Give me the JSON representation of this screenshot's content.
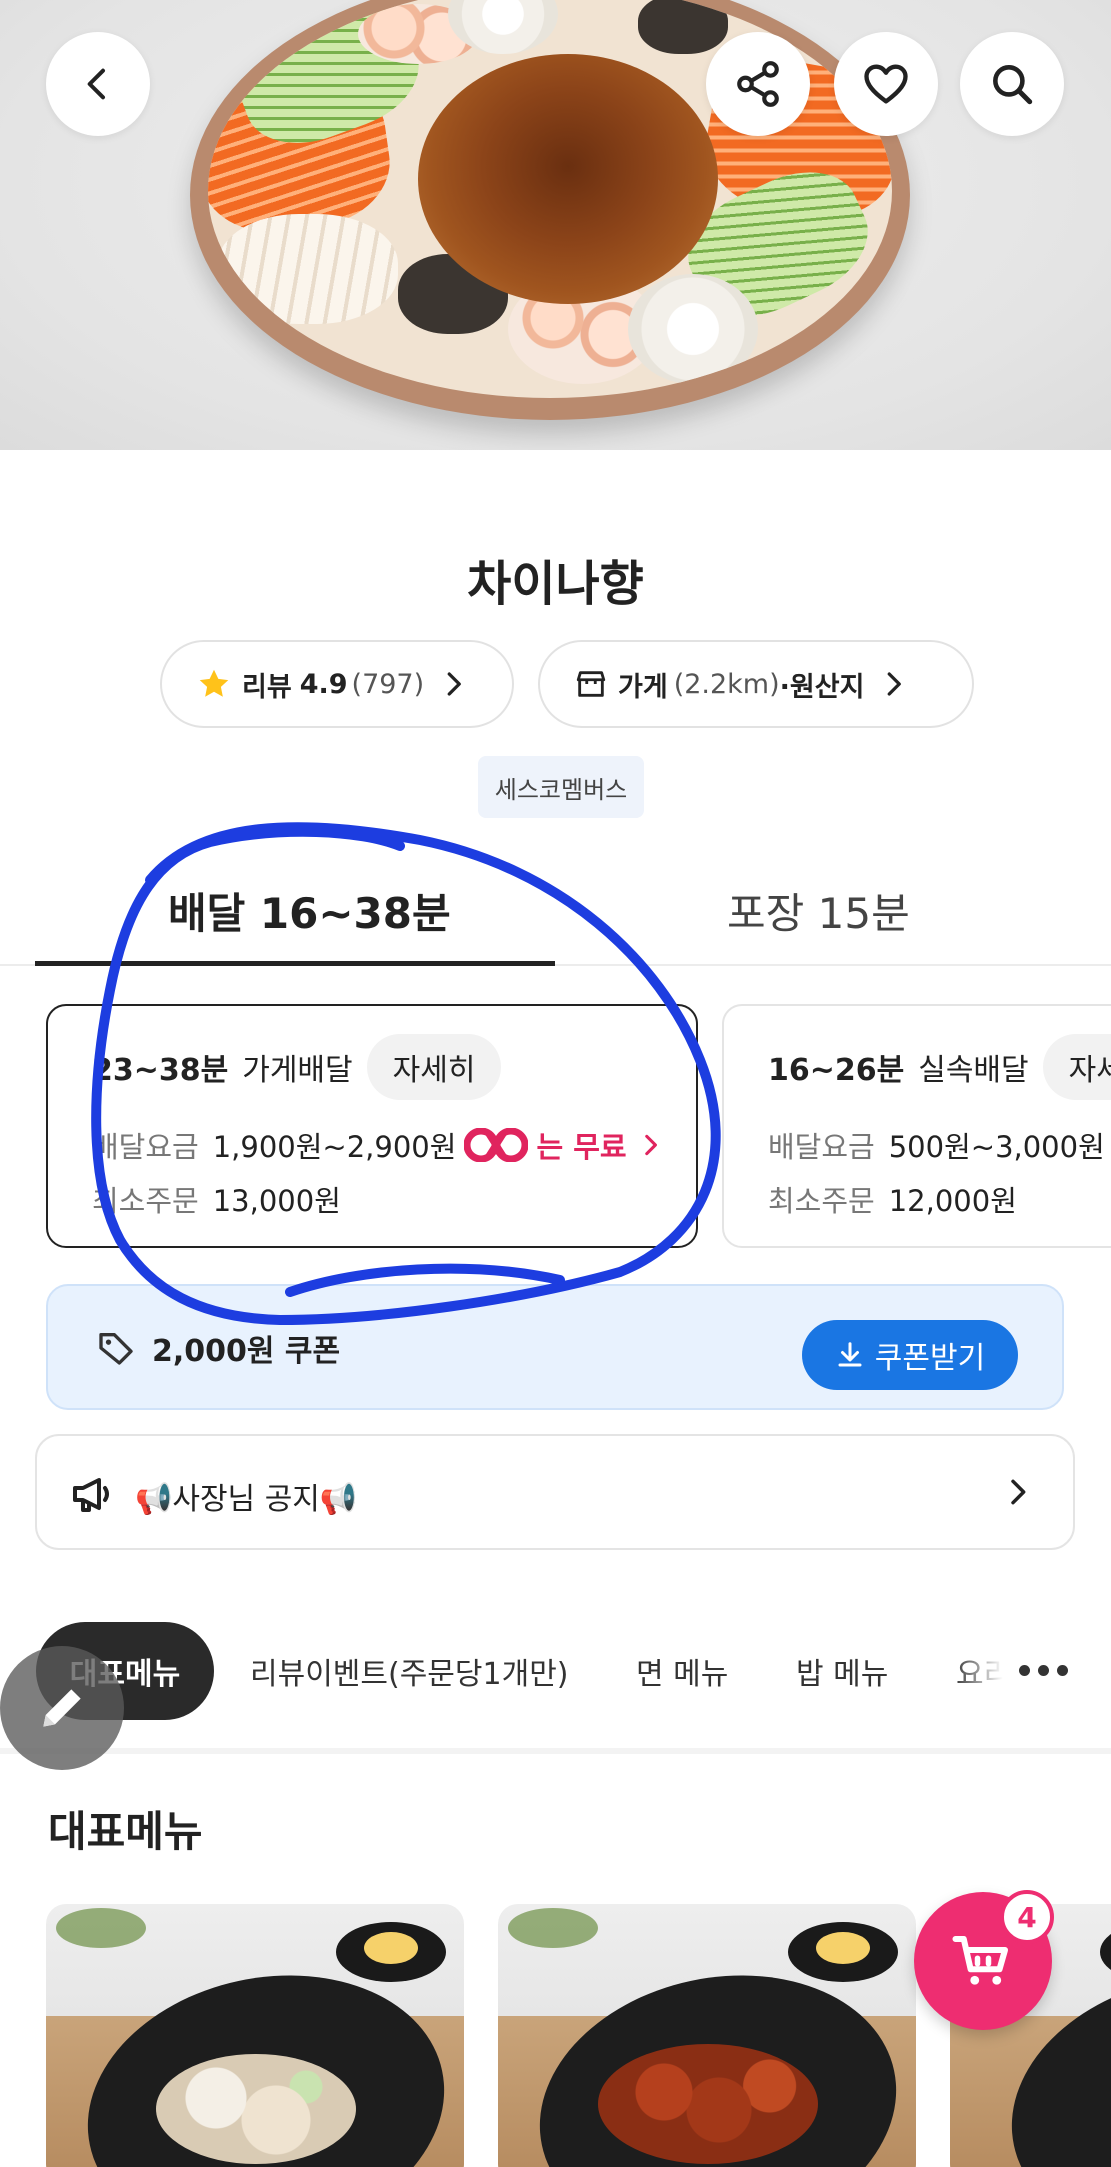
{
  "header": {
    "back_icon": "chevron-left-icon",
    "share_icon": "share-icon",
    "favorite_icon": "heart-icon",
    "search_icon": "search-icon"
  },
  "store": {
    "name": "차이나향",
    "review": {
      "label": "리뷰",
      "rating": "4.9",
      "count": "(797)"
    },
    "info": {
      "label": "가게",
      "distance": "(2.2km)",
      "origin": "·원산지"
    },
    "tag": "세스코멤버스"
  },
  "tabs": [
    {
      "label": "배달 16~38분",
      "active": true
    },
    {
      "label": "포장 15분",
      "active": false
    }
  ],
  "delivery_options": [
    {
      "time": "23~38분",
      "type": "가게배달",
      "detail_label": "자세히",
      "fee_label": "배달요금",
      "fee": "1,900원~2,900원",
      "free_text": "는 무료",
      "min_label": "최소주문",
      "min_order": "13,000원",
      "selected": true
    },
    {
      "time": "16~26분",
      "type": "실속배달",
      "detail_label": "자세히",
      "fee_label": "배달요금",
      "fee": "500원~3,000원",
      "min_label": "최소주문",
      "min_order": "12,000원",
      "selected": false
    }
  ],
  "coupon": {
    "text": "2,000원 쿠폰",
    "button": "쿠폰받기"
  },
  "notice": {
    "text": "📢사장님 공지📢"
  },
  "categories": [
    "대표메뉴",
    "리뷰이벤트(주문당1개만)",
    "면 메뉴",
    "밥 메뉴",
    "요리"
  ],
  "section": {
    "title": "대표메뉴"
  },
  "cart": {
    "count": "4"
  },
  "colors": {
    "accent_pink": "#ee2d71",
    "coupon_blue": "#1a76e3",
    "coupon_bg": "#e8f2fe",
    "annotation_blue": "#1d3de0"
  }
}
